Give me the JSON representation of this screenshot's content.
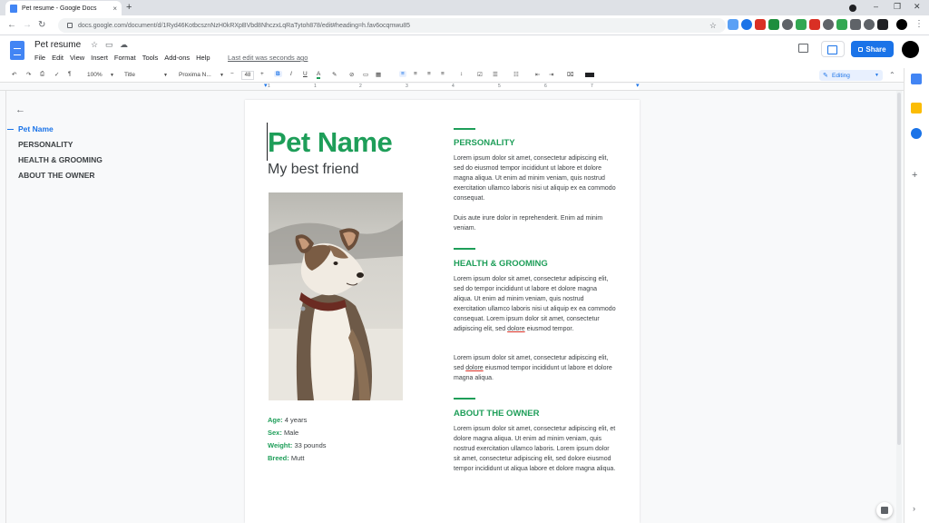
{
  "browser": {
    "tab_title": "Pet resume - Google Docs",
    "tab_close": "×",
    "new_tab": "+",
    "url": "docs.google.com/document/d/1Ryd46KotbcsznNzH0kRXpBVbd8NhczxLqRaTytoh878/edit#heading=h.fav6ocqmwu85",
    "back": "←",
    "forward": "→",
    "reload": "↻",
    "bookmark": "☆",
    "kebab": "⋮",
    "minimize": "–",
    "maximize": "❐",
    "close": "✕",
    "ext_colors": [
      "#5aa0f5",
      "#1a73e8",
      "#d93025",
      "#1e8e3e",
      "#5f6368",
      "#34a853",
      "#d93025",
      "#5f6368",
      "#34a853",
      "#5f6368",
      "#5f6368",
      "#202124"
    ]
  },
  "docs": {
    "title": "Pet resume",
    "star_icon": "☆",
    "move_icon": "▭",
    "cloud_icon": "☁",
    "menu": [
      "File",
      "Edit",
      "View",
      "Insert",
      "Format",
      "Tools",
      "Add-ons",
      "Help"
    ],
    "last_edit": "Last edit was seconds ago",
    "share_label": "Share"
  },
  "toolbar": {
    "undo": "↶",
    "redo": "↷",
    "print": "⎙",
    "spell": "✓",
    "paint": "¶",
    "zoom": "100%",
    "style": "Title",
    "font": "Proxima N...",
    "minus": "−",
    "size": "48",
    "plus": "+",
    "bold": "B",
    "italic": "I",
    "underline": "U",
    "color": "A",
    "highlight": "✎",
    "link": "⊘",
    "comment": "▭",
    "image": "▦",
    "align_left": "≡",
    "align_center": "≡",
    "align_right": "≡",
    "align_justify": "≡",
    "line_spacing": "↕",
    "checklist": "☑",
    "bullets": "☰",
    "numbered": "☷",
    "indent_less": "⇤",
    "indent_more": "⇥",
    "clear": "⌧",
    "editing": "Editing",
    "collapse": "⌃"
  },
  "ruler": {
    "numbers": [
      "1",
      "1",
      "2",
      "3",
      "4",
      "5",
      "6",
      "7"
    ]
  },
  "outline": {
    "back": "←",
    "items": [
      "Pet Name",
      "PERSONALITY",
      "HEALTH & GROOMING",
      "ABOUT THE OWNER"
    ]
  },
  "document": {
    "pet_name": "Pet Name",
    "subtitle": "My best friend",
    "facts": [
      {
        "label": "Age:",
        "value": "4 years"
      },
      {
        "label": "Sex:",
        "value": "Male"
      },
      {
        "label": "Weight:",
        "value": "33 pounds"
      },
      {
        "label": "Breed:",
        "value": "Mutt"
      }
    ],
    "sections": [
      {
        "heading": "PERSONALITY",
        "paragraphs": [
          "Lorem ipsum dolor sit amet, consectetur adipiscing elit, sed do eiusmod tempor incididunt ut labore et dolore magna aliqua. Ut enim ad minim veniam, quis nostrud exercitation ullamco laboris nisi ut aliquip ex ea commodo consequat.",
          "Duis aute irure dolor in reprehenderit. Enim ad minim veniam."
        ]
      },
      {
        "heading": "HEALTH & GROOMING",
        "p1_before": "Lorem ipsum dolor sit amet, consectetur adipiscing elit, sed do tempor incididunt ut labore et dolore magna aliqua. Ut enim ad minim veniam, quis nostrud exercitation ullamco laboris nisi ut aliquip ex ea commodo consequat. Lorem ipsum dolor sit amet, consectetur adipiscing elit, sed ",
        "p1_underlined": "dolore",
        "p1_after": " eiusmod tempor.",
        "p2_before": "Lorem ipsum dolor sit amet, consectetur adipiscing elit, sed ",
        "p2_underlined": "dolore",
        "p2_after": " eiusmod tempor incididunt ut labore et dolore magna aliqua."
      },
      {
        "heading": "ABOUT THE OWNER",
        "paragraphs": [
          "Lorem ipsum dolor sit amet, consectetur adipiscing elit, et dolore magna aliqua. Ut enim ad minim veniam, quis nostrud exercitation ullamco laboris. Lorem ipsum dolor sit amet, consectetur adipiscing elit, sed dolore eiusmod tempor incididunt ut aliqua labore et dolore magna aliqua."
        ]
      }
    ]
  },
  "sidepanel": {
    "plus": "+",
    "arrow": "›",
    "icon_colors": [
      "#4285f4",
      "#fbbc04",
      "#1a73e8"
    ]
  },
  "colors": {
    "accent_green": "#1e9e59",
    "docs_blue": "#1a73e8"
  }
}
